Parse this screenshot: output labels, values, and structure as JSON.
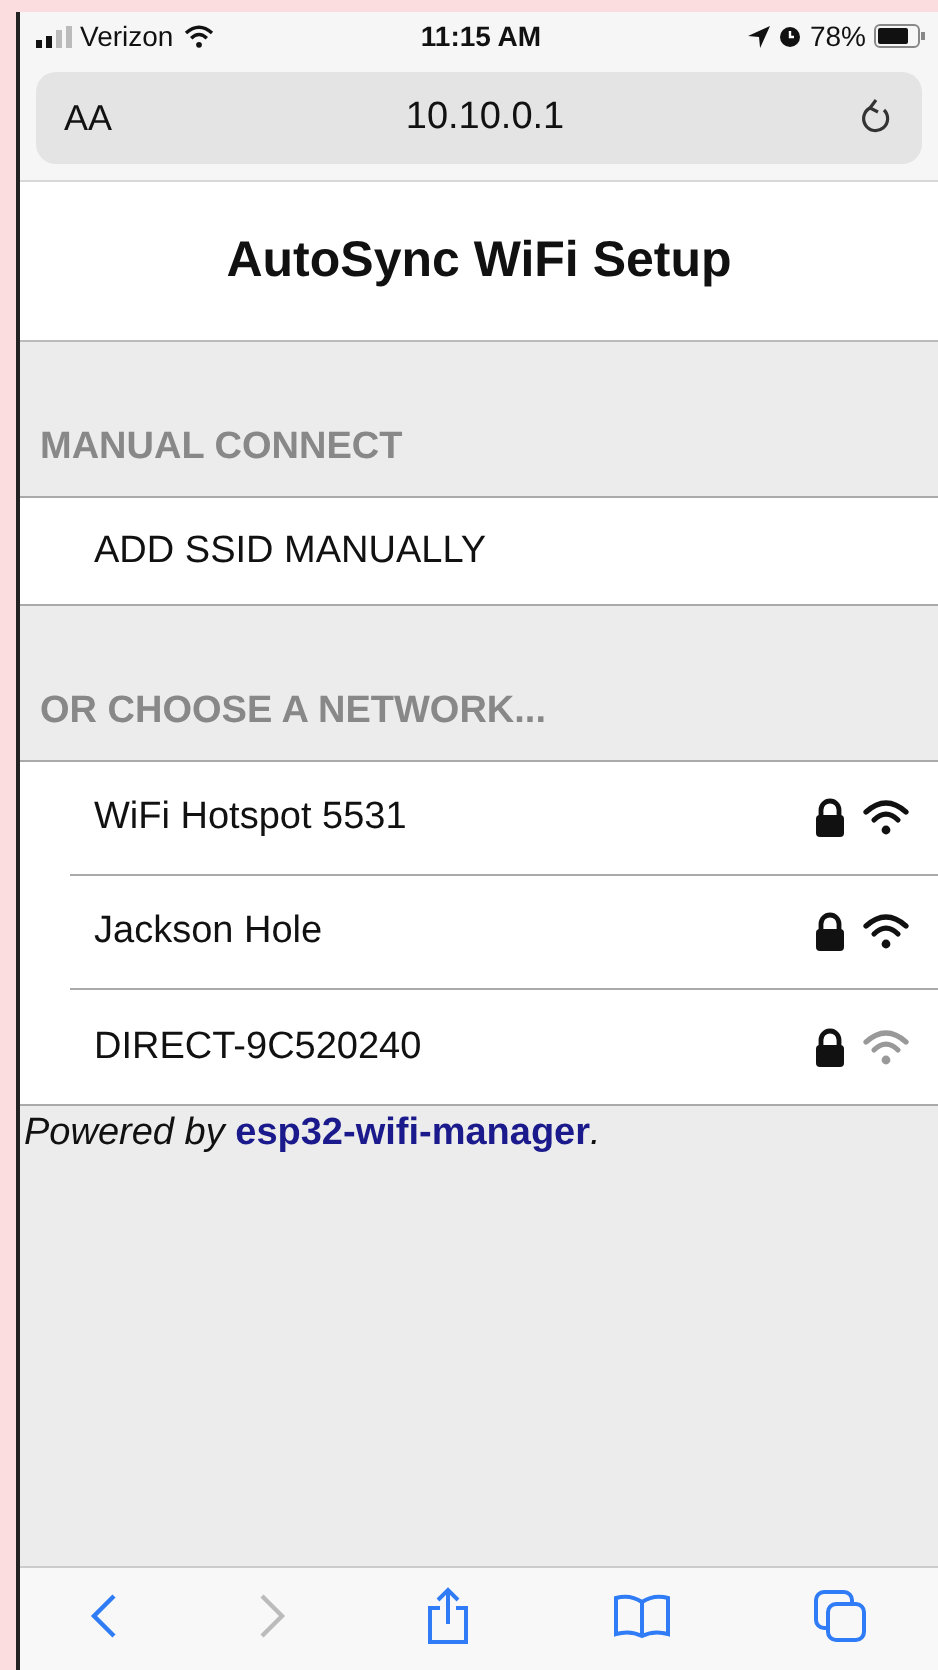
{
  "status_bar": {
    "carrier": "Verizon",
    "time": "11:15 AM",
    "battery": "78%"
  },
  "address_bar": {
    "text_size": "AA",
    "url": "10.10.0.1"
  },
  "page": {
    "title": "AutoSync WiFi Setup",
    "manual_section": {
      "heading": "MANUAL CONNECT",
      "item": "ADD SSID MANUALLY"
    },
    "networks_section": {
      "heading": "OR CHOOSE A NETWORK...",
      "networks": [
        {
          "name": "WiFi Hotspot 5531",
          "secured": true,
          "strong_signal": true
        },
        {
          "name": "Jackson Hole",
          "secured": true,
          "strong_signal": true
        },
        {
          "name": "DIRECT-9C520240",
          "secured": true,
          "strong_signal": false
        }
      ]
    },
    "footer": {
      "before": "Powered by",
      "link": "esp32-wifi-manager",
      "after": "."
    }
  },
  "toolbar": {
    "back_disabled": false,
    "forward_disabled": true
  }
}
